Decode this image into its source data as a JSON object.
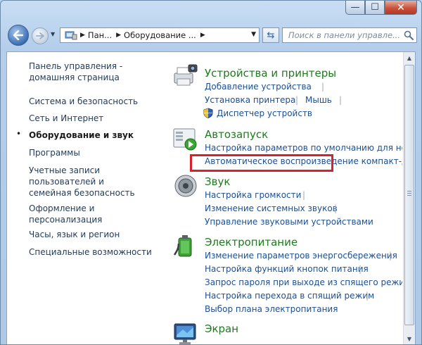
{
  "window": {
    "caption_buttons": {
      "minimize": "—",
      "maximize": "☐",
      "close": "✕"
    }
  },
  "navigation": {
    "address_segments": [
      "Пан...",
      "Оборудование ..."
    ],
    "search_placeholder": "Поиск в панели управле..."
  },
  "sidebar": {
    "items": [
      {
        "label": "Панель управления - домашняя страница",
        "current": false
      },
      {
        "label": "Система и безопасность",
        "current": false
      },
      {
        "label": "Сеть и Интернет",
        "current": false
      },
      {
        "label": "Оборудование и звук",
        "current": true
      },
      {
        "label": "Программы",
        "current": false
      },
      {
        "label": "Учетные записи пользователей и семейная безопасность",
        "current": false
      },
      {
        "label": "Оформление и персонализация",
        "current": false
      },
      {
        "label": "Часы, язык и регион",
        "current": false
      },
      {
        "label": "Специальные возможности",
        "current": false
      }
    ]
  },
  "categories": {
    "devices": {
      "title": "Устройства и принтеры",
      "links": [
        "Добавление устройства",
        "Установка принтера",
        "Мышь",
        "Диспетчер устройств"
      ],
      "icon": "printer-camera-icon"
    },
    "autoplay": {
      "title": "Автозапуск",
      "links": [
        "Настройка параметров по умолчанию для но",
        "Автоматическое воспроизведение компакт-д"
      ],
      "icon": "autoplay-icon"
    },
    "sound": {
      "title": "Звук",
      "links": [
        "Настройка громкости",
        "Изменение системных звуков",
        "Управление звуковыми устройствами"
      ],
      "icon": "speaker-icon"
    },
    "power": {
      "title": "Электропитание",
      "links": [
        "Изменение параметров энергосбережения",
        "Настройка функций кнопок питания",
        "Запрос пароля при выходе из спящего режим",
        "Настройка перехода в спящий режим",
        "Выбор плана электропитания"
      ],
      "icon": "battery-icon"
    },
    "display": {
      "title": "Экран",
      "icon": "monitor-icon"
    }
  },
  "colors": {
    "category_title": "#1f7a1f",
    "link": "#1a4f96",
    "highlight": "#d6222a"
  }
}
